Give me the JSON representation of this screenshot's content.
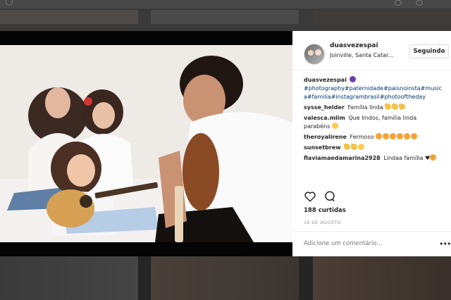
{
  "post": {
    "username": "duasvezespai",
    "location": "Joinville, Santa Catar...",
    "follow_label": "Seguindo",
    "caption_user": "duasvezespai",
    "caption_tags": "#photography#paternidade#paisnoinsta#musica#familia#instagrambrasil#photooftheday",
    "likes": "188 curtidas",
    "date": "16 DE AGOSTO",
    "add_comment_placeholder": "Adicione um comentário...",
    "more_label": "•••"
  },
  "comments": [
    {
      "user": "sysse_helder",
      "text": "Família linda",
      "emoji": "clap x3"
    },
    {
      "user": "valesca.mlim",
      "text": "Que lindos, família linda parabéns",
      "emoji": "smile"
    },
    {
      "user": "theroyalirene",
      "text": "Fermoso",
      "emoji": "heart-eyes x6"
    },
    {
      "user": "sunsetbrew",
      "text": "",
      "emoji": "raised-hands x2, smile"
    },
    {
      "user": "flaviamaedamarina2928",
      "text": "Lindaa família",
      "emoji": "heart, heart-eyes"
    }
  ],
  "colors": {
    "accent_link": "#003569",
    "text": "#262626",
    "muted": "#999999"
  }
}
